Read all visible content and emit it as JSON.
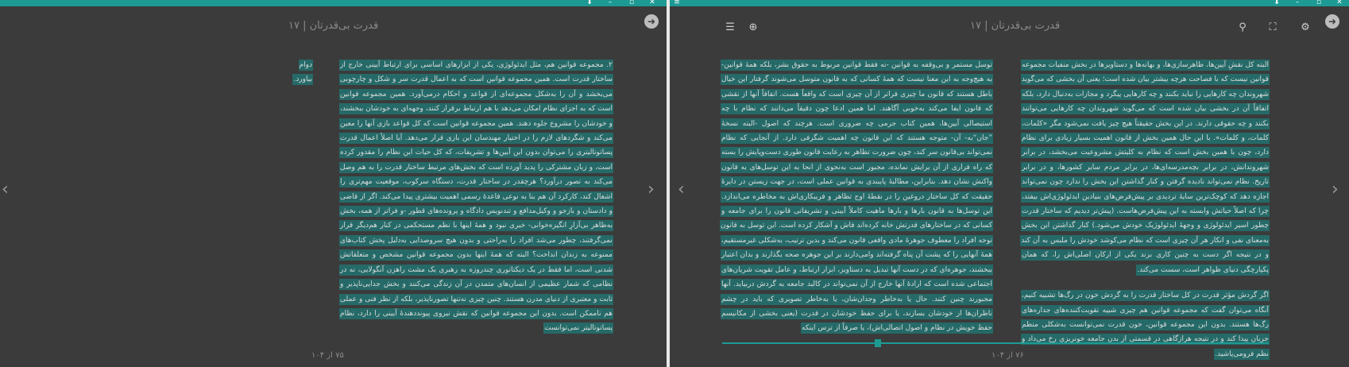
{
  "left": {
    "book_title": "قدرت بی‌قدرتان | ۱۷",
    "page_num": "۷۵ از ۱۰۴",
    "prev_arrow": "‹",
    "next_arrow": "›",
    "back_glyph": "➜",
    "side_note": "دوام بیاورد.",
    "paragraph": "۲. مجموعه قوانین هم، مثل ایدئولوژی، یکی از ابزارهای اساسی برای ارتباط آیینی خارج از ساختار قدرت است. همین مجموعه قوانین است که به اعمال قدرت سر و شکل و چارچوبی می‌بخشد و آن را به‌شکل مجموعه‌ای از قواعد و احکام درمی‌آورد. همین مجموعه قوانین است که به اجزای نظام امکان می‌دهد با هم ارتباط برقرار کنند، وجهه‌ای به خودشان ببخشند، و خودشان را مشروع جلوه دهند. همین مجموعه قوانین است که کل قواعد بازی آنها را معین می‌کند و شگردهای لازم را در اختیار مهندسان این بازی قرار می‌دهد. آیا اصلاً اعمال قدرت پساتوتالیتری را می‌توان بدون این آیین‌ها و تشریفات، که کل حیات این نظام را مقدور کرده است، و زبان مشترکی را پدید آورده است که بخش‌های مرتبط ساختار قدرت را به هم وصل می‌کند به تصور درآورد؟ هرچقدر در ساختار قدرت، دستگاه سرکوب، موقعیت مهم‌تری را اشغال کند، کارکرد آن هم بنا به نوعی قاعدهٔ رسمی اهمیت بیشتری پیدا می‌کند. اگر از قاضی و دادستان و بازجو و وکیل‌مدافع و تندنویس دادگاه و پرونده‌های قطور -و فراتر از همه، بخش به‌ظاهر بی‌آزارِ انگیزه‌خوانی- خبری نبود و همهٔ اینها با نظم مستحکمی در کنار هم‌دیگر قرار نمی‌گرفتند، چطور می‌شد افراد را به‌راحتی و بدون هیچ سروصدایی به‌دلیل پخش کتاب‌های ممنوعه به زندان انداخت؟ البته که همهٔ اینها بدون مجموعه قوانین مشخص و متعلقاتش شدنی است، اما فقط در یک دیکتاتوری چندروزه به رهبری یک مشت راهزن آنگولایی، نه در نظامی که شمار عظیمی از انسان‌های متمدن در آن زندگی می‌کنند و بخش جدایی‌ناپذیر و ثابت و معتبری از دنیای مدرن هستند. چنین چیزی نه‌تنها تصورناپذیر، بلکه از نظر فنی و عملی هم ناممکن است. بدون این مجموعه قوانین که نقش نیروی پیونددهندهٔ آیینی را دارد، نظام پساتوتالیتر نمی‌توانست"
  },
  "right": {
    "book_title": "قدرت بی‌قدرتان | ۱۷",
    "page_num": "۷۶ از ۱۰۴",
    "prev_arrow": "‹",
    "next_arrow": "›",
    "back_glyph": "➜",
    "col_right_p1": "البته کل نقشِ آیین‌ها، ظاهرسازی‌ها، و بهانه‌ها و دستاویزها در بخش منفیات مجموعه قوانین نیست که با فصاحت هرچه بیشتر بیان شده است؛ یعنی آن بخشی که می‌گوید شهروندان چه کارهایی را نباید بکنند و چه کارهایی پیگرد و مجازات به‌دنبال دارد، بلکه اتفاقاً آن در بخشی بیان شده است که می‌گوید شهروندان چه کارهایی می‌توانند بکنند و چه حقوقی دارند. در این بخش حقیقتاً هیچ چیز یافت نمی‌شود مگر «کلمات، کلمات، و کلمات». با این حال همین بخش از قانون اهمیت بسیار زیادی برای نظام دارد، چون با همین بخش است که نظام به کلیتش مشروعیت می‌بخشد، در برابر شهروندانش، در برابر بچه‌مدرسه‌ای‌ها، در برابر مردم سایر کشورها، و در برابر تاریخ. نظام نمی‌تواند نادیده گرفتن و کنار گذاشتن این بخش را ندارد چون نمی‌تواند اجازه دهد که کوچک‌ترین سایهٔ تردیدی بر پیش‌فرض‌های بنیادین ایدئولوژی‌اش بیفتد، چرا که اصلاً حیاتش وابسته به این پیش‌فرض‌هاست. (پیش‌تر دیدیم که ساختار قدرت چطور اسیر ایدئولوژی و وجههٔ ایدئولوژیک خودش می‌شود.) کنار گذاشتن این بخش به‌معنای نفی و انکار هر آن چیزی است که نظام می‌کوشد خودش را ملبس به آن کند و در نتیجه اگر دست به چنین کاری بزند یکی از ارکان اصلی‌اش را، که همان پکپارچگی دنیای ظواهر است، سست می‌کند.",
    "col_right_p2": "اگر گردش مؤثر قدرت در کل ساختار قدرت را به گردش خون در رگ‌ها تشبیه کنیم، آنگاه می‌توان گفت که مجموعه قوانین هم چیزی شبیه تقویت‌کننده‌های جداره‌های رگ‌ها هستند. بدون این مجموعه قوانین، خون قدرت نمی‌توانست به‌شکلی منظم جریان پیدا کند و در نتیجه هرازگاهی در قسمتی از بدن جامعه خونریزی رخ می‌داد و نظم فرومی‌پاشید.",
    "col_left_p1": "توسل مستمر و بی‌وقفه به قوانین -نه فقط قوانین مربوط به حقوق بشر، بلکه همهٔ قوانین- به هیچ‌وجه به این معنا نیست که همهٔ کسانی که به قانون متوسل می‌شوند گرفتار این خیال باطل هستند که قانون ما چیزی فراتر از آن چیزی است که واقعاً هست. اتفاقاً آنها از نقشی که قانون ایفا می‌کند به‌خوبی آگاهند. اما همین ادعا چون دقیقاً می‌دانند که نظام با چه استیصالی آیین‌ها، همین کتاب جرمی چه ضروری است. هرچند که اصول -البته نسخهٔ ”جان“به- آن- متوجه هستند که این قانون چه اهمیت شگرفی دارد. از آنجایی که نظام نمی‌تواند بی‌قانون سر کند، چون ضرورت تظاهر به رعایت قانون طوری دست‌وپایش را بسته که راه فراری از آن برایش نمانده، مجبور است به‌نحوی از انحا به این توسل‌های به قانون واکنش نشان دهد. بنابراین، مطالبهٔ پایبندی به قوانین عملی است، در جهت زیستن در دایرهٔ حقیقت که کل ساختار دروغین را در نقطهٔ اوج تظاهر و فریبکاری‌اش به مخاطره می‌اندازد. این توسل‌ها به قانون بارها و بارها ماهیت کاملاً آیینی و تشریفاتی قانون را برای جامعه و کسانی که در ساختارهای قدرتش خانه کرده‌اند فاش و آشکار کرده است. این توسل به قانون توجه افراد را معطوف جوهرهٔ مادی واقعی قانون می‌کند و بدین ترتیب، به‌شکلی غیرمستقیم، همهٔ آنهایی را که پشت آن پناه گرفته‌اند وامی‌دارند بر این جوهره صحه بگذارند و بدان اعتبار ببخشند، جوهره‌ای که در دست آنها تبدیل به دستاویز، ابزار ارتباط، و عامل تقویت شریان‌های اجتماعی شده است که ارادهٔ آنها خارج از آن نمی‌تواند در کالبد جامعه به گردش دربیاید. آنها مجبورند چنین کنند. حال یا به‌خاطر وجدان‌شان، یا به‌خاطر تصویری که باید در چشم ناظران‌ها از خودشان بسازند، یا برای حفظ خودشان در قدرت (یعنی بخشی از مکانیسم حفظ خویش در نظام و اصول اتصالی‌اش)، یا صرفاً از ترس اینکه"
  },
  "icons": {
    "settings": "gear-icon",
    "fullscreen": "fullscreen-icon",
    "search": "search-icon",
    "zoom": "zoom-in-icon",
    "toc": "list-icon",
    "download": "download-icon",
    "minimize": "minimize-icon",
    "maximize": "maximize-icon",
    "close": "close-icon",
    "menu": "menu-icon"
  },
  "colors": {
    "accent": "#1d9a93",
    "highlight": "#256a68",
    "background": "#3b3b3b"
  },
  "reading_progress": 0.28
}
